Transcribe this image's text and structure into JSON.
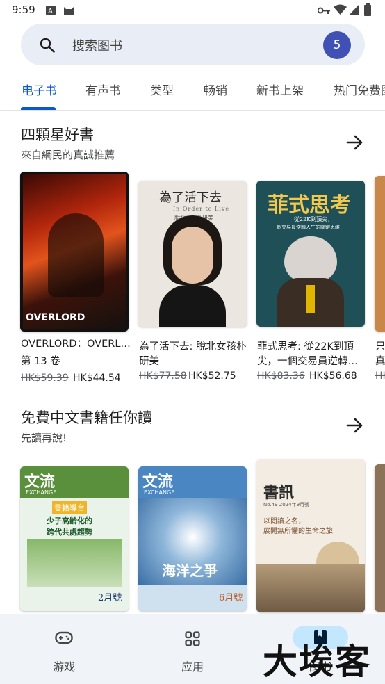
{
  "status_bar": {
    "time": "9:59"
  },
  "search": {
    "placeholder": "搜索图书",
    "account_badge": "5"
  },
  "tabs": [
    {
      "label": "电子书",
      "active": true
    },
    {
      "label": "有声书"
    },
    {
      "label": "类型"
    },
    {
      "label": "畅销"
    },
    {
      "label": "新书上架"
    },
    {
      "label": "热门免费图"
    }
  ],
  "sections": [
    {
      "title": "四顆星好書",
      "subtitle": "來自網民的真誠推薦",
      "books": [
        {
          "title": "OVERLORD：OVERL…",
          "subtitle": "第 13 卷",
          "old_price": "HK$59.39",
          "price": "HK$44.54",
          "cover_text": [
            "OVERLORD"
          ]
        },
        {
          "title": "為了活下去: 脫北女孩朴研美",
          "old_price": "HK$77.58",
          "price": "HK$52.75",
          "cover_text": [
            "為了活下去",
            "In Order to Live",
            "脫北女孩朴研美"
          ]
        },
        {
          "title": "菲式思考: 從22K到頂尖，一個交易員逆轉…",
          "old_price": "HK$83.36",
          "price": "HK$56.68",
          "cover_text": [
            "菲式思考",
            "從22K到頂尖，",
            "一個交易員逆轉人生的關鍵思維"
          ]
        },
        {
          "title": "只真",
          "old_price": "HK"
        }
      ]
    },
    {
      "title": "免費中文書籍任你讀",
      "subtitle": "先讀再說!",
      "books": [
        {
          "cover_text": [
            "文流",
            "EXCHANGE",
            "書籍導台",
            "少子高齡化的",
            "跨代共處趨勢",
            "2月號"
          ]
        },
        {
          "cover_text": [
            "文流",
            "EXCHANGE",
            "海洋之爭",
            "6月號"
          ]
        },
        {
          "cover_text": [
            "書訊",
            "No.49 2024年9月號",
            "以閱讀之名，",
            "展開無所懼的生命之旅"
          ]
        }
      ]
    }
  ],
  "bottom_nav": [
    {
      "label": "游戏",
      "icon": "gamepad-icon"
    },
    {
      "label": "应用",
      "icon": "apps-grid-icon"
    },
    {
      "label": "图书",
      "icon": "bookmark-book-icon",
      "active": true
    }
  ],
  "watermark": "大埃客",
  "colors": {
    "accent": "#0b57d0",
    "badge": "#3f51b5",
    "nav_bg": "#f0f4f9",
    "active_pill": "#c2e7ff"
  }
}
